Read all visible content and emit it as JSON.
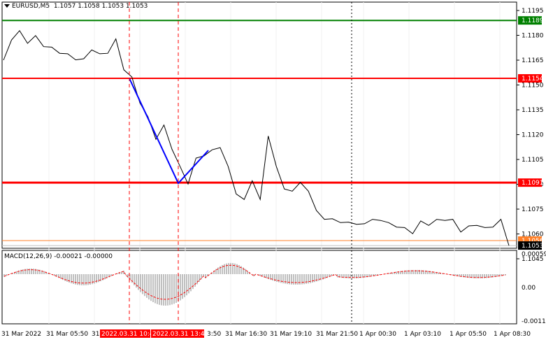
{
  "header": {
    "symbol": "EURUSD,M5",
    "ohlc": "1.1057 1.1058 1.1053 1.1053"
  },
  "macd": {
    "label": "MACD(12,26,9) -0.00021 -0.00000",
    "axis_labels": [
      "0.00059",
      "0.00",
      "-0.00118"
    ]
  },
  "price_axis": {
    "ticks": [
      "1.1195",
      "1.1180",
      "1.1165",
      "1.1150",
      "1.1135",
      "1.1120",
      "1.1105",
      "1.1090",
      "1.1075",
      "1.1060",
      "1.1045"
    ]
  },
  "levels": [
    {
      "name": "resistance-top",
      "price": "1.1189",
      "color": "#008000"
    },
    {
      "name": "resistance-mid",
      "price": "1.1154",
      "color": "#ff0000"
    },
    {
      "name": "support",
      "price": "1.1091",
      "color": "#ff0000"
    },
    {
      "name": "ask",
      "price": "1.1056",
      "color": "#ff7f27"
    },
    {
      "name": "bid",
      "price": "1.1053",
      "color": "#000000"
    }
  ],
  "time_axis": {
    "labels": [
      "31 Mar 2022",
      "31 Mar 05:50",
      "31",
      "3:50",
      "31 Mar 16:30",
      "31 Mar 19:10",
      "31 Mar 21:50",
      "1 Apr 00:30",
      "1 Apr 03:10",
      "1 Apr 05:50",
      "1 Apr 08:30"
    ],
    "highlight": [
      "2022.03.31 10:4",
      "2022.03.31 13:40"
    ]
  },
  "chart_data": {
    "type": "line",
    "title": "EURUSD,M5",
    "ylim": [
      1.104,
      1.12
    ],
    "series": [
      {
        "name": "EURUSD,M5",
        "values": [
          1.1165,
          1.1178,
          1.1182,
          1.1176,
          1.1179,
          1.1174,
          1.1172,
          1.117,
          1.1168,
          1.1166,
          1.1165,
          1.1172,
          1.1168,
          1.117,
          1.1177,
          1.116,
          1.1154,
          1.114,
          1.113,
          1.1118,
          1.1125,
          1.1112,
          1.11,
          1.1091,
          1.1105,
          1.1108,
          1.111,
          1.1113,
          1.11,
          1.1085,
          1.108,
          1.1093,
          1.108,
          1.112,
          1.11,
          1.1088,
          1.1085,
          1.1092,
          1.1085,
          1.1075,
          1.1068,
          1.107,
          1.1066,
          1.1068,
          1.1065,
          1.1067,
          1.1068,
          1.1069,
          1.1066,
          1.1065,
          1.1063,
          1.1061,
          1.1067,
          1.1066,
          1.1068,
          1.1069,
          1.1068,
          1.1062,
          1.1064,
          1.1066,
          1.1063,
          1.1065,
          1.1068,
          1.1053
        ]
      }
    ]
  }
}
